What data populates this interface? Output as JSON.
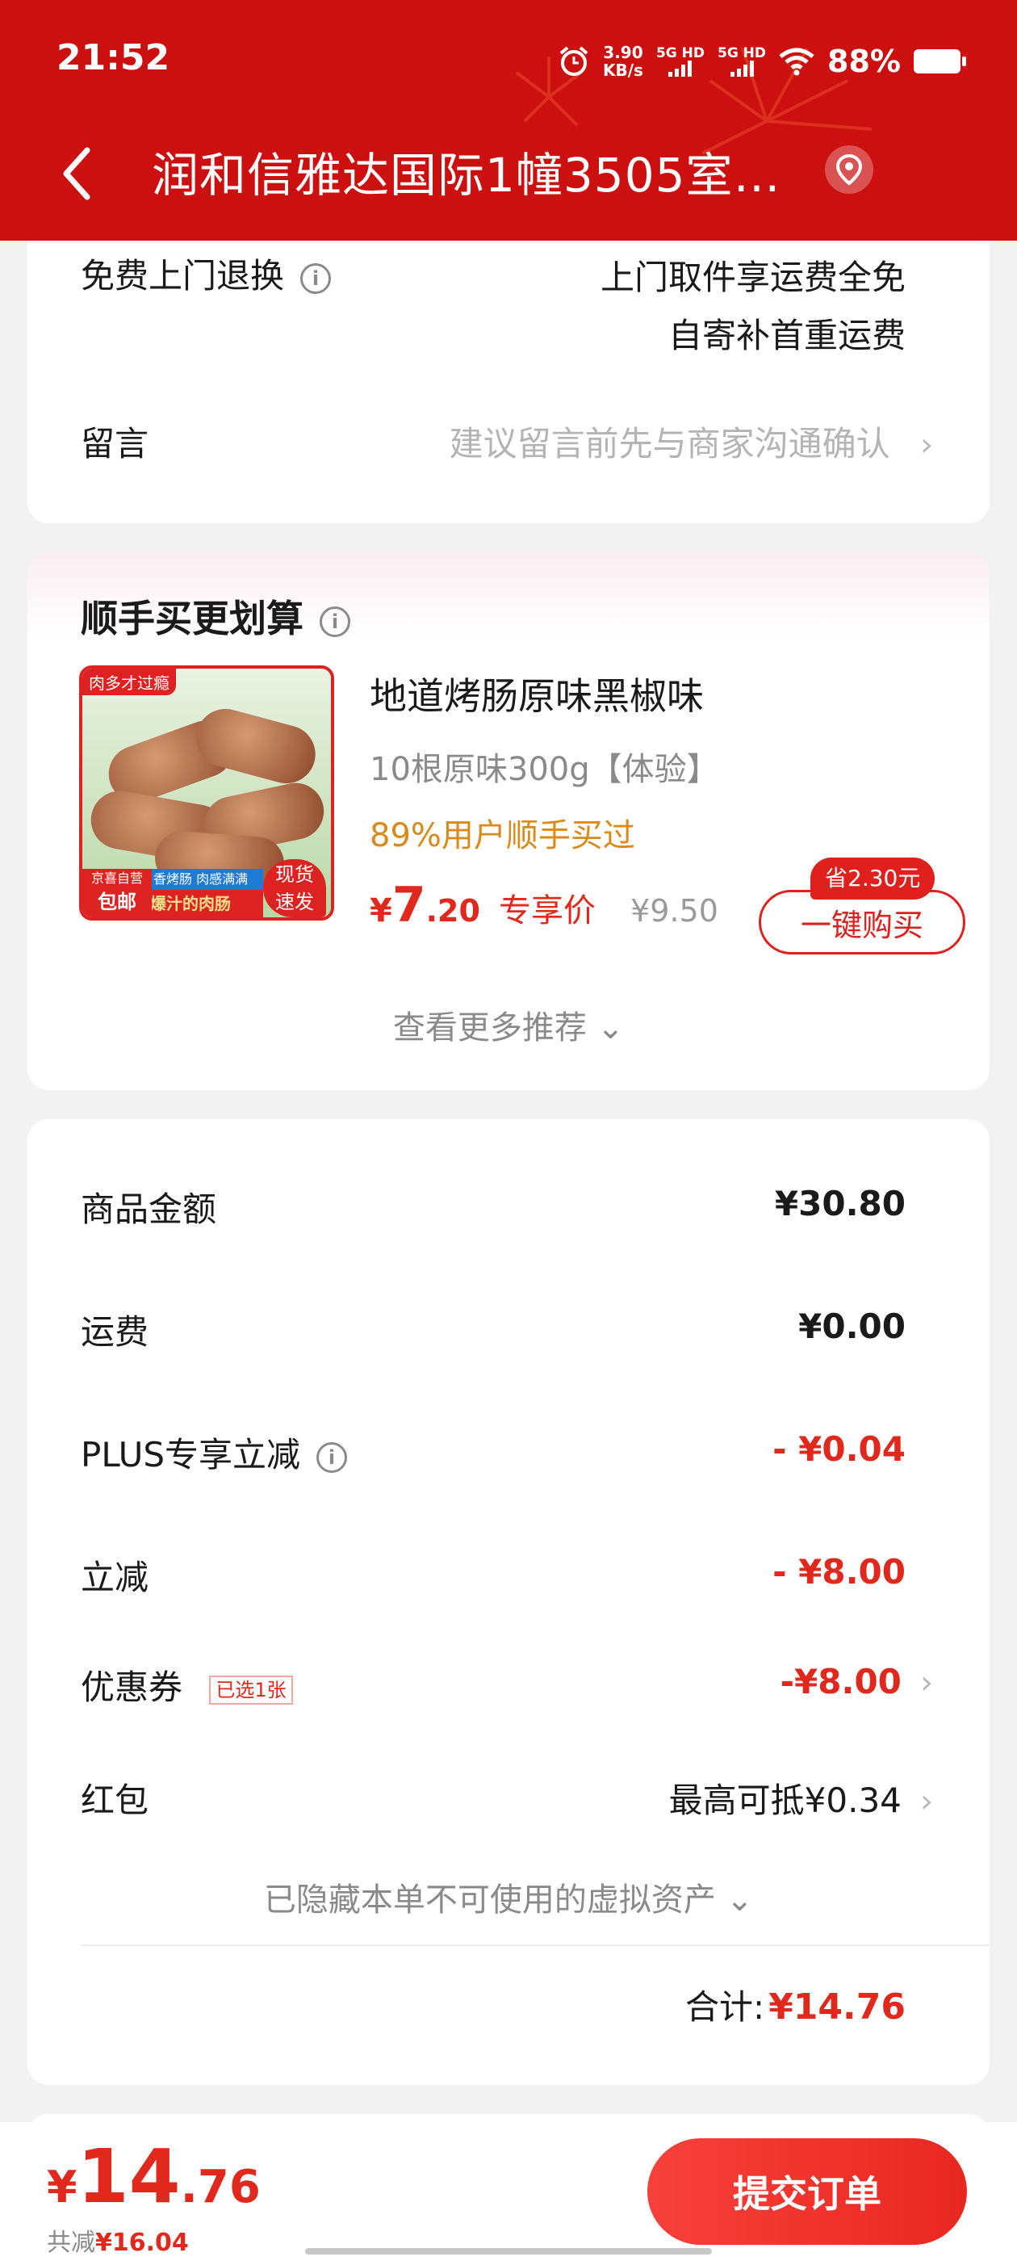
{
  "status_bar": {
    "time": "21:52",
    "net_speed_top": "3.90",
    "net_speed_bottom": "KB/s",
    "sim1": "5G HD",
    "sim2": "5G HD",
    "battery": "88%"
  },
  "header": {
    "address": "润和信雅达国际1幢3505室…"
  },
  "return_section": {
    "label": "免费上门退换",
    "line1": "上门取件享运费全免",
    "line2": "自寄补首重运费",
    "message_label": "留言",
    "message_placeholder": "建议留言前先与商家沟通确认"
  },
  "upsell": {
    "title": "顺手买更划算",
    "image_tag": "肉多才过瘾",
    "image_badge_left_top": "京喜自营",
    "image_badge_left_bottom": "包邮",
    "image_strip_top": "香烤肠 肉感满满",
    "image_strip_bottom": "爆汁的肉肠",
    "image_badge_right": "现货速发",
    "product_name": "地道烤肠原味黑椒味",
    "spec": "10根原味300g【体验】",
    "buy_rate": "89%用户顺手买过",
    "currency": "¥",
    "price_int": "7",
    "price_dec": ".20",
    "price_tag": "专享价",
    "orig_price": "¥9.50",
    "save_badge": "省2.30元",
    "buy_button": "一键购买",
    "more": "查看更多推荐"
  },
  "summary": {
    "goods_label": "商品金额",
    "goods_value": "¥30.80",
    "shipping_label": "运费",
    "shipping_value": "¥0.00",
    "plus_label": "PLUS专享立减",
    "plus_value": "- ¥0.04",
    "discount_label": "立减",
    "discount_value": "- ¥8.00",
    "coupon_label": "优惠券",
    "coupon_tag": "已选1张",
    "coupon_value": "-¥8.00",
    "redpacket_label": "红包",
    "redpacket_value": "最高可抵¥0.34",
    "hidden_assets": "已隐藏本单不可使用的虚拟资产",
    "total_label": "合计:",
    "total_value": "¥14.76"
  },
  "bottom": {
    "currency": "¥",
    "total_int": "14",
    "total_dec": ".76",
    "saved_label": "共减",
    "saved_value": "¥16.04",
    "submit": "提交订单"
  },
  "colors": {
    "header_red": "#cc1010",
    "accent_red": "#e0281c",
    "orange": "#d98a1a"
  }
}
